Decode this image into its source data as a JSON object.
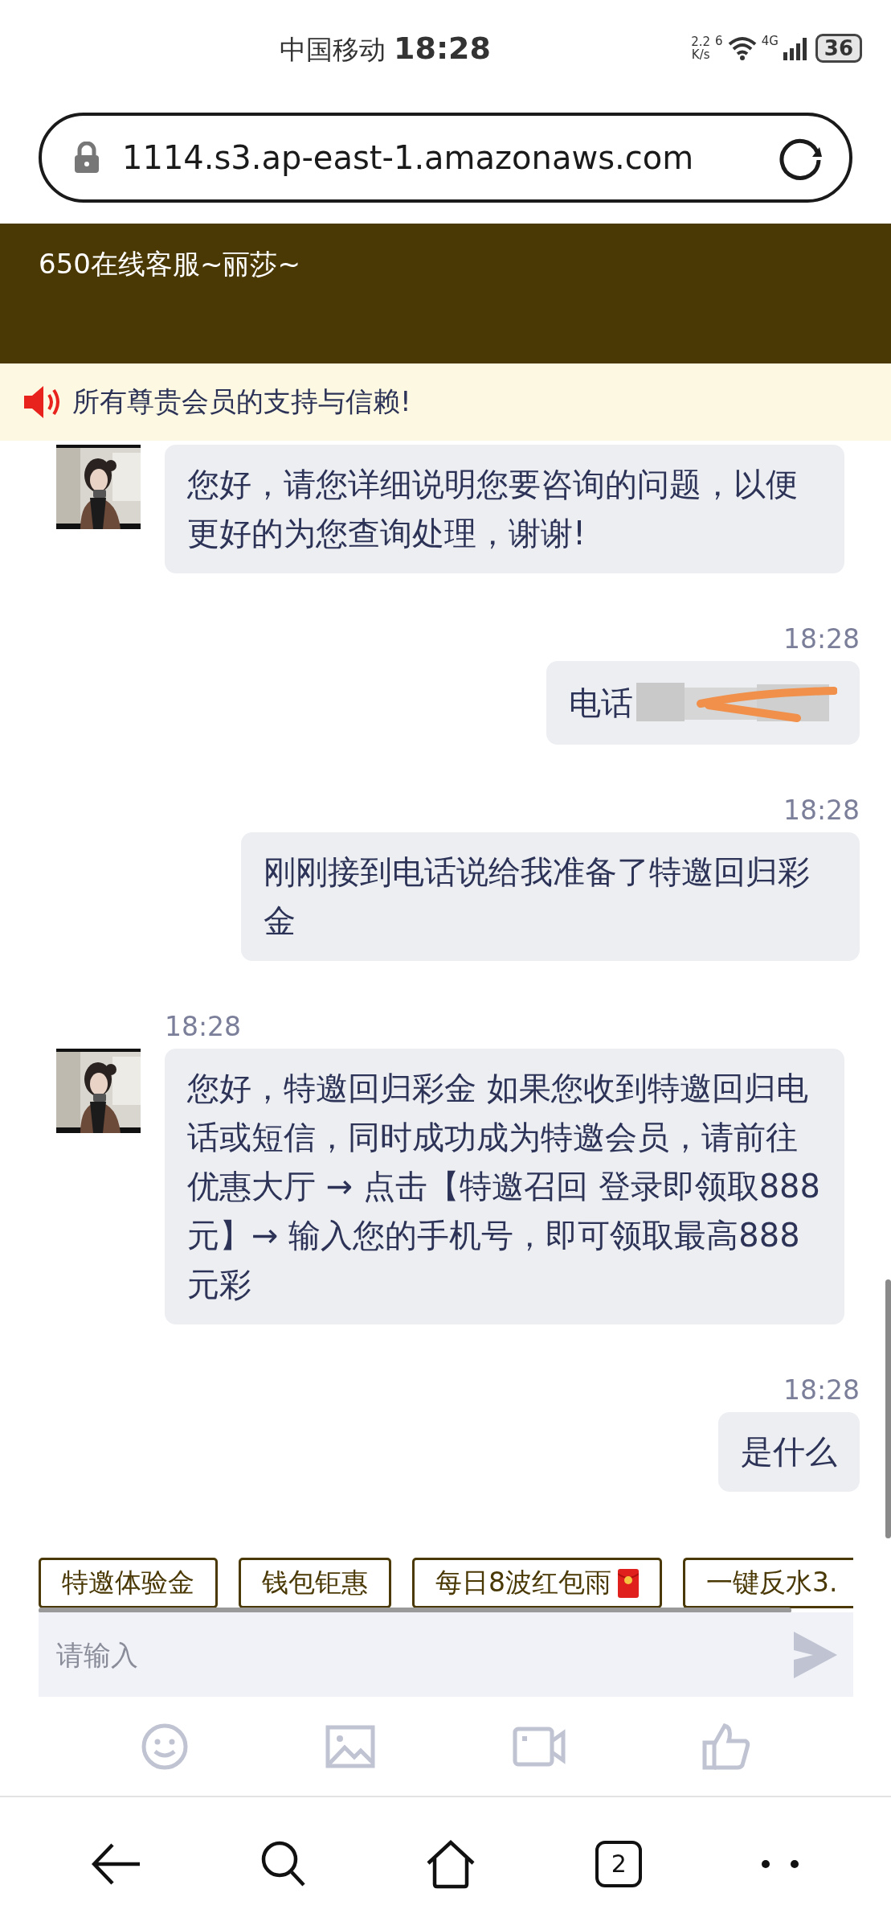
{
  "status_bar": {
    "carrier": "中国移动",
    "time": "18:28",
    "net_speed": "2.2",
    "net_speed_unit": "K/s",
    "wifi_badge": "6",
    "network_type": "4G",
    "battery": "36"
  },
  "address_bar": {
    "url": "1114.s3.ap-east-1.amazonaws.com"
  },
  "chat_header": {
    "title": "650在线客服~丽莎~"
  },
  "notice": {
    "text": "所有尊贵会员的支持与信赖!"
  },
  "messages": [
    {
      "kind": "agent",
      "text": "您好，请您详细说明您要咨询的问题，以便更好的为您查询处理，谢谢!",
      "redacted": false
    },
    {
      "kind": "user",
      "time": "18:28",
      "text": "电话",
      "redacted": true
    },
    {
      "kind": "user",
      "time": "18:28",
      "text": "刚刚接到电话说给我准备了特邀回归彩金",
      "redacted": false
    },
    {
      "kind": "agent",
      "time": "18:28",
      "text": "您好，特邀回归彩金 如果您收到特邀回归电话或短信，同时成功成为特邀会员，请前往优惠大厅 → 点击【特邀召回 登录即领取888元】→ 输入您的手机号，即可领取最高888元彩",
      "redacted": false
    },
    {
      "kind": "user",
      "time": "18:28",
      "text": "是什么",
      "redacted": false
    }
  ],
  "quick_replies": [
    {
      "kind": "text",
      "label": "特邀体验金"
    },
    {
      "kind": "text",
      "label": "钱包钜惠"
    },
    {
      "kind": "icon",
      "label": "每日8波红包雨"
    },
    {
      "kind": "text",
      "label": "一键反水3."
    }
  ],
  "composer": {
    "placeholder": "请输入"
  },
  "nav_bar": {
    "tab_count": "2"
  }
}
